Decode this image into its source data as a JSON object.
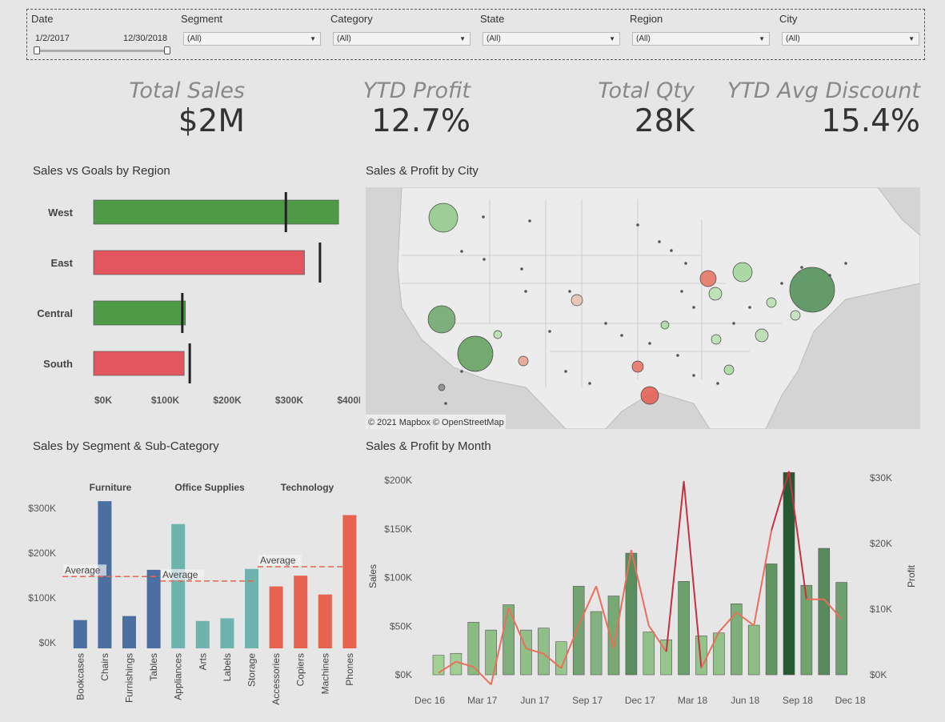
{
  "filters": {
    "date": {
      "label": "Date",
      "start": "1/2/2017",
      "end": "12/30/2018"
    },
    "dropdowns": [
      {
        "label": "Segment",
        "value": "(All)"
      },
      {
        "label": "Category",
        "value": "(All)"
      },
      {
        "label": "State",
        "value": "(All)"
      },
      {
        "label": "Region",
        "value": "(All)"
      },
      {
        "label": "City",
        "value": "(All)"
      }
    ]
  },
  "kpis": [
    {
      "label": "Total Sales",
      "value": "$2M"
    },
    {
      "label": "YTD Profit",
      "value": "12.7%"
    },
    {
      "label": "Total Qty",
      "value": "28K"
    },
    {
      "label": "YTD Avg Discount",
      "value": "15.4%"
    }
  ],
  "sections": {
    "goals": "Sales vs Goals by Region",
    "map": "Sales & Profit by City",
    "segment": "Sales by Segment & Sub-Category",
    "month": "Sales & Profit by Month"
  },
  "map": {
    "attribution": "© 2021 Mapbox © OpenStreetMap",
    "background": "#d4d4d4"
  },
  "colors": {
    "green": "#4e9a46",
    "red": "#e3555f",
    "blue": "#4a6fa0",
    "teal": "#6eb3ad",
    "orange": "#e8634f",
    "profit_line": "#e8705a",
    "goal_marker": "#222222"
  },
  "chart_data": [
    {
      "type": "bar",
      "title": "Sales vs Goals by Region",
      "categories": [
        "West",
        "East",
        "Central",
        "South"
      ],
      "series": [
        {
          "name": "Sales",
          "values": [
            395000,
            340000,
            148000,
            146000
          ]
        },
        {
          "name": "Goal",
          "values": [
            310000,
            365000,
            143000,
            155000
          ]
        }
      ],
      "bar_colors": [
        "green",
        "red",
        "green",
        "red"
      ],
      "xticks": [
        "$0K",
        "$100K",
        "$200K",
        "$300K",
        "$400K"
      ],
      "xlim": [
        0,
        400000
      ]
    },
    {
      "type": "bar",
      "title": "Sales by Segment & Sub-Category",
      "groups": [
        "Furniture",
        "Office Supplies",
        "Technology"
      ],
      "categories": [
        "Bookcases",
        "Chairs",
        "Furnishings",
        "Tables",
        "Appliances",
        "Arts",
        "Labels",
        "Storage",
        "Accessories",
        "Copiers",
        "Machines",
        "Phones"
      ],
      "group_of": [
        0,
        0,
        0,
        0,
        1,
        1,
        1,
        1,
        2,
        2,
        2,
        2
      ],
      "values": [
        63000,
        328000,
        72000,
        175000,
        277000,
        61000,
        67000,
        177000,
        138000,
        162000,
        120000,
        297000
      ],
      "averages": [
        {
          "group": "Furniture",
          "value": 160000,
          "label": "Average"
        },
        {
          "group": "Office Supplies",
          "value": 150000,
          "label": "Average"
        },
        {
          "group": "Technology",
          "value": 182000,
          "label": "Average"
        }
      ],
      "yticks": [
        "$0K",
        "$100K",
        "$200K",
        "$300K"
      ],
      "ylim": [
        0,
        330000
      ]
    },
    {
      "type": "bar",
      "title": "Sales & Profit by Month",
      "ylabel": "Sales",
      "y2label": "Profit",
      "x": [
        "Dec 16",
        "Jan 17",
        "Feb 17",
        "Mar 17",
        "Apr 17",
        "May 17",
        "Jun 17",
        "Jul 17",
        "Aug 17",
        "Sep 17",
        "Oct 17",
        "Nov 17",
        "Dec 17",
        "Jan 18",
        "Feb 18",
        "Mar 18",
        "Apr 18",
        "May 18",
        "Jun 18",
        "Jul 18",
        "Aug 18",
        "Sep 18",
        "Oct 18",
        "Nov 18",
        "Dec 18"
      ],
      "xticks": [
        "Dec 16",
        "Mar 17",
        "Jun 17",
        "Sep 17",
        "Dec 17",
        "Mar 18",
        "Jun 18",
        "Sep 18",
        "Dec 18"
      ],
      "series": [
        {
          "name": "Sales",
          "values": [
            20000,
            22000,
            54000,
            46000,
            72000,
            46000,
            48000,
            34000,
            91000,
            65000,
            81000,
            125000,
            44000,
            36000,
            96000,
            40000,
            43000,
            73000,
            51000,
            114000,
            208000,
            92000,
            130000,
            95000
          ]
        },
        {
          "name": "Profit",
          "values": [
            300,
            2000,
            1200,
            -1500,
            10200,
            4000,
            3200,
            1000,
            7500,
            13500,
            4000,
            19000,
            7500,
            3500,
            29500,
            1000,
            6500,
            9500,
            7500,
            22000,
            31000,
            11500,
            11500,
            8500
          ]
        }
      ],
      "yticks": [
        "$0K",
        "$50K",
        "$100K",
        "$150K",
        "$200K"
      ],
      "y2ticks": [
        "$0K",
        "$10K",
        "$20K",
        "$30K"
      ],
      "ylim": [
        0,
        200000
      ],
      "y2lim": [
        0,
        30000
      ]
    }
  ]
}
